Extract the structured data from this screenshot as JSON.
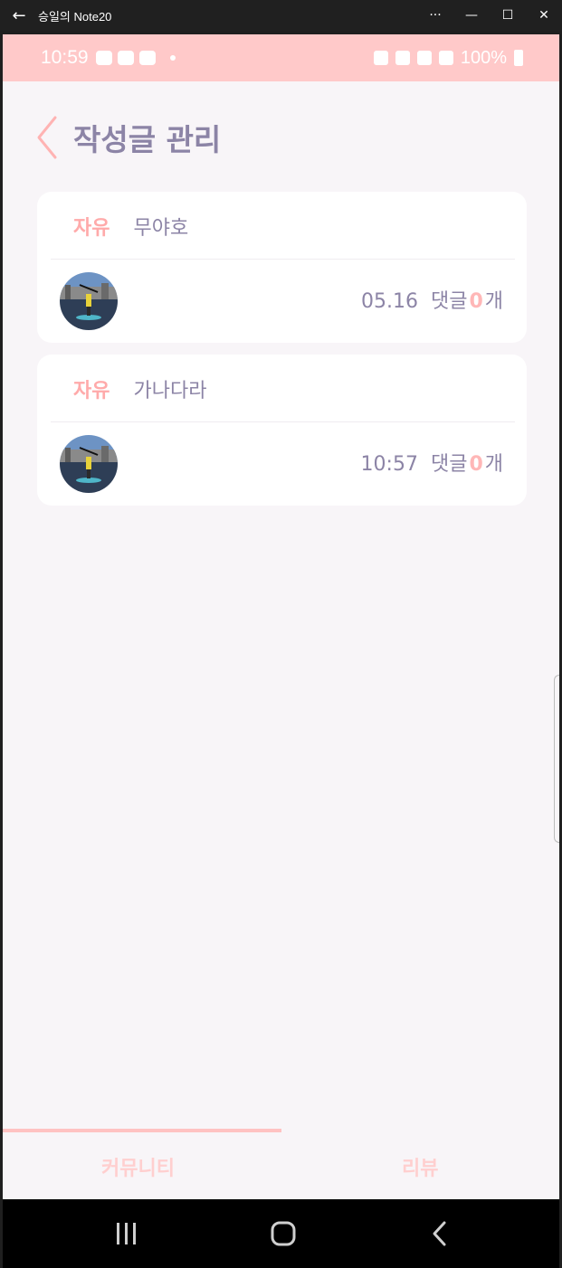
{
  "window": {
    "title": "승일의 Note20",
    "back_icon": "←",
    "more_icon": "···",
    "minimize_icon": "—",
    "maximize_icon": "☐",
    "close_icon": "✕"
  },
  "statusbar": {
    "time": "10:59",
    "battery": "100%",
    "background": "#ffc9c9"
  },
  "header": {
    "title": "작성글 관리"
  },
  "posts": [
    {
      "category": "자유",
      "title": "무야호",
      "date": "05.16",
      "comment_label": "댓글",
      "comment_count": "0",
      "comment_unit": "개"
    },
    {
      "category": "자유",
      "title": "가나다라",
      "date": "10:57",
      "comment_label": "댓글",
      "comment_count": "0",
      "comment_unit": "개"
    }
  ],
  "tabs": {
    "community": "커뮤니티",
    "review": "리뷰",
    "active": "community"
  },
  "colors": {
    "accent": "#ffb7b7",
    "text": "#8c84a6",
    "background": "#f8f5f8"
  }
}
